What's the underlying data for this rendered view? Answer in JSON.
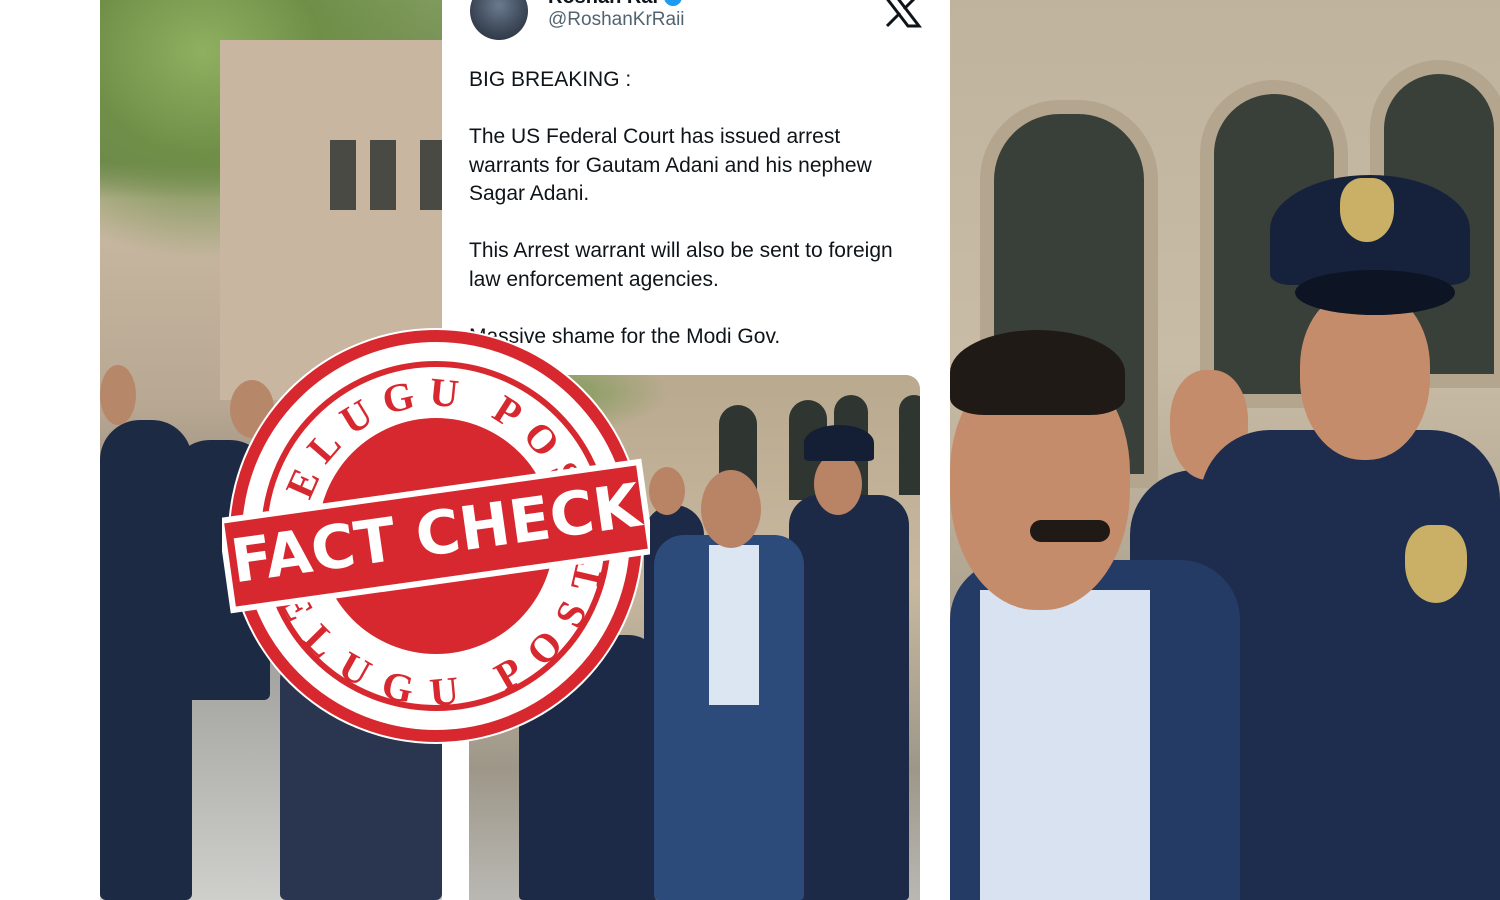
{
  "tweet": {
    "display_name": "Roshan Rai",
    "handle": "@RoshanKrRaii",
    "verified_glyph": "✓",
    "platform_icon": "x-logo-icon",
    "text": "BIG BREAKING :\n\nThe US Federal Court has issued arrest warrants for Gautam Adani and his nephew Sagar Adani.\n\nThis Arrest warrant will also be sent to foreign law enforcement agencies.\n\nMassive shame for the Modi Gov."
  },
  "stamp": {
    "top_text": "TELUGU POST",
    "center_text": "FACT CHECK",
    "bottom_text": "TELUGU POST",
    "color": "#d8282f"
  },
  "colors": {
    "verified": "#1d9bf0",
    "text": "#0f1419",
    "handle": "#536471"
  }
}
